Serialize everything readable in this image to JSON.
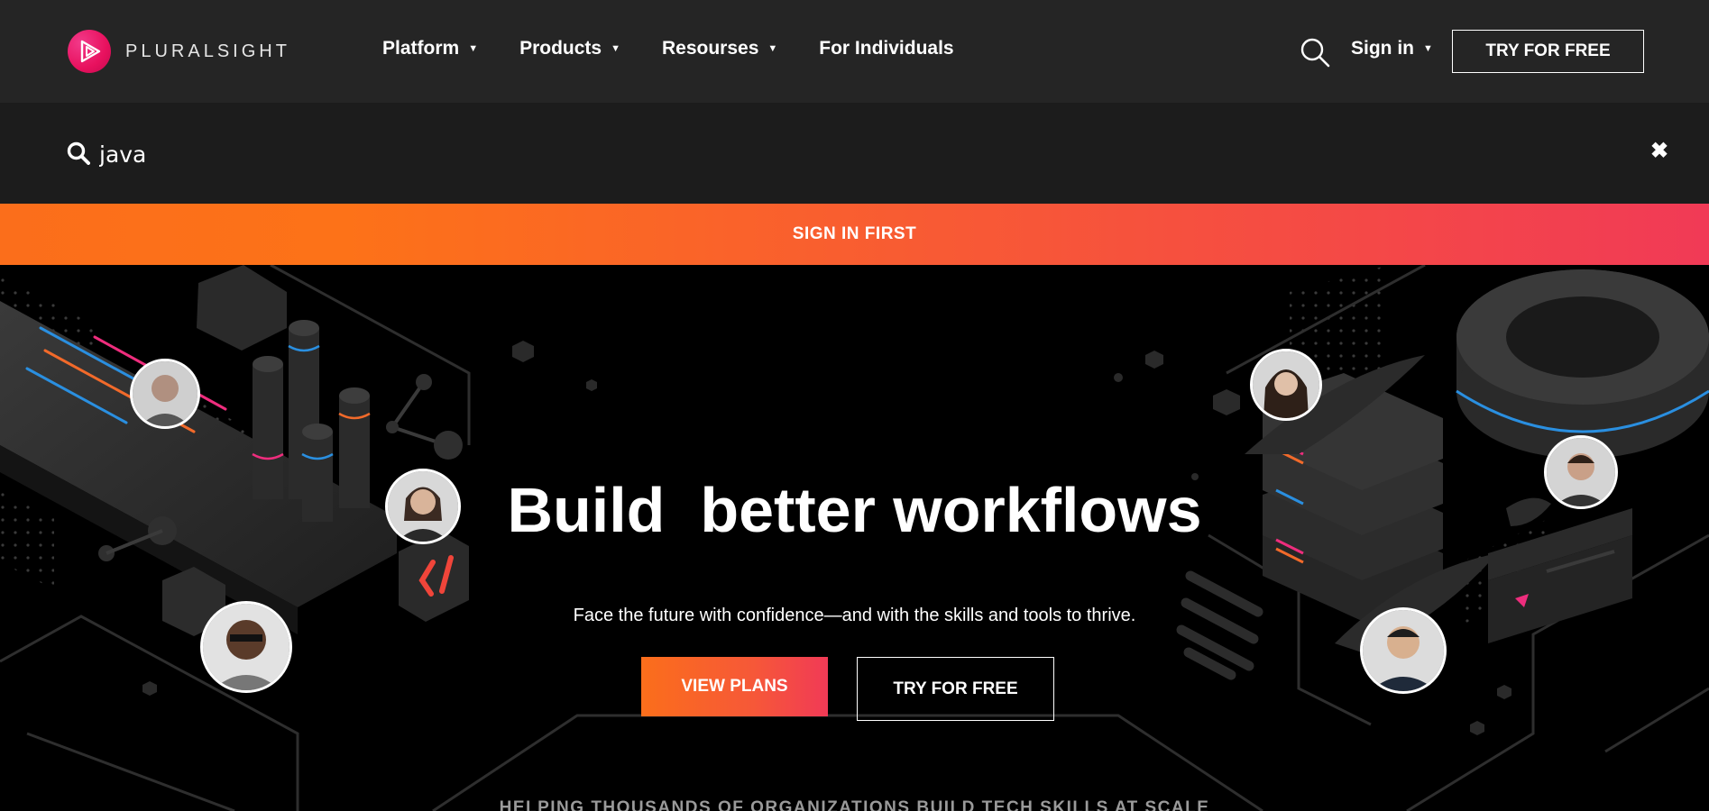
{
  "header": {
    "logo_text": "PLURALSIGHT",
    "nav": [
      {
        "label": "Platform",
        "has_menu": true
      },
      {
        "label": "Products",
        "has_menu": true
      },
      {
        "label": "Resourses",
        "has_menu": true
      },
      {
        "label": "For Individuals",
        "has_menu": false
      }
    ],
    "sign_in_label": "Sign in",
    "try_free_label": "TRY FOR FREE",
    "caret": "▼"
  },
  "search": {
    "value": "java",
    "close_glyph": "✖"
  },
  "banner": {
    "label": "SIGN IN FIRST"
  },
  "hero": {
    "headline_words": [
      "Build",
      "better",
      "workflows"
    ],
    "subheadline": "Face the future with confidence—and with the skills and tools to thrive.",
    "view_plans_label": "VIEW PLANS",
    "try_free_label": "TRY FOR FREE",
    "tagline": "HELPING THOUSANDS OF ORGANIZATIONS BUILD TECH SKILLS AT SCALE"
  },
  "colors": {
    "accent_orange": "#fb6e1b",
    "accent_pink": "#f13a56",
    "logo_pink": "#e8115e",
    "nav_bg": "#252525",
    "search_bg": "#1c1c1c"
  }
}
